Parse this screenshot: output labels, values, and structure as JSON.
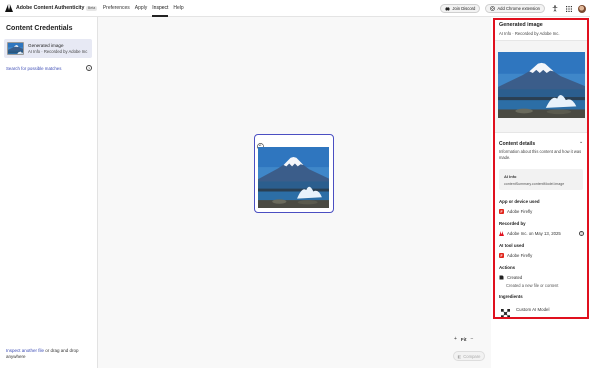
{
  "app": {
    "title": "Adobe Content Authenticity",
    "badge": "Beta",
    "nav": [
      {
        "label": "Preferences",
        "active": false
      },
      {
        "label": "Apply",
        "active": false
      },
      {
        "label": "Inspect",
        "active": true
      },
      {
        "label": "Help",
        "active": false
      }
    ],
    "join_discord": "Join Discord",
    "add_chrome": "Add Chrome extension",
    "brand_color": "#e0101e",
    "accent_color": "#4b4fc2"
  },
  "sidebar": {
    "title": "Content Credentials",
    "card": {
      "title": "Generated image",
      "subtitle": "AI Info · Recorded by Adobe Inc"
    },
    "search_link": "Search for possible matches",
    "help_glyph": "?",
    "bottom_link": "Inspect another file",
    "bottom_text": " or drag and drop anywhere"
  },
  "canvas": {
    "zoom_in": "+",
    "zoom_label": "Fit",
    "zoom_out": "−",
    "compare_label": "Compare"
  },
  "panel": {
    "title": "Generated image",
    "subtitle": "AI Info · Recorded by Adobe Inc.",
    "content_details": {
      "heading": "Content details",
      "description": "Information about this content and how it was made.",
      "ai_info_title": "AI Info",
      "ai_info_value": "contentSummary.contentModel.image"
    },
    "app_device": {
      "label": "App or device used",
      "value": "Adobe Firefly"
    },
    "recorded_by": {
      "label": "Recorded by",
      "value": "Adobe Inc. on May 13, 2025"
    },
    "ai_tool": {
      "label": "AI tool used",
      "value": "Adobe Firefly"
    },
    "actions": {
      "label": "Actions",
      "value": "Created",
      "description": "Created a new file or content"
    },
    "ingredients": {
      "label": "Ingredients",
      "value": "Custom AI Model"
    }
  }
}
